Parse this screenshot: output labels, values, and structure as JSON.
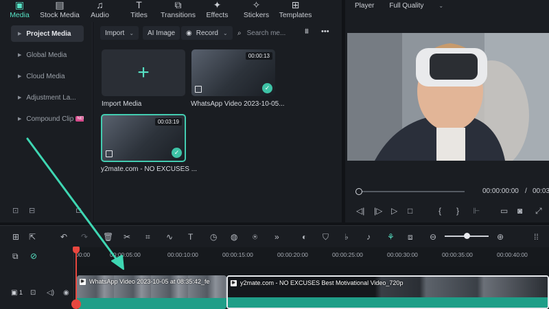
{
  "top_tabs": [
    {
      "label": "Media",
      "icon": "media-icon",
      "active": true
    },
    {
      "label": "Stock Media",
      "icon": "stock-media-icon"
    },
    {
      "label": "Audio",
      "icon": "music-note-icon"
    },
    {
      "label": "Titles",
      "icon": "text-icon"
    },
    {
      "label": "Transitions",
      "icon": "transitions-icon"
    },
    {
      "label": "Effects",
      "icon": "effects-icon"
    },
    {
      "label": "Stickers",
      "icon": "sticker-icon"
    },
    {
      "label": "Templates",
      "icon": "templates-icon"
    }
  ],
  "sidebar": {
    "items": [
      {
        "label": "Project Media",
        "active": true
      },
      {
        "label": "Global Media"
      },
      {
        "label": "Cloud Media"
      },
      {
        "label": "Adjustment La..."
      },
      {
        "label": "Compound Clip",
        "badge": "NEW"
      }
    ]
  },
  "media_toolbar": {
    "import_label": "Import",
    "ai_image_label": "AI Image",
    "record_label": "Record",
    "search_placeholder": "Search me..."
  },
  "media_items": [
    {
      "caption": "Import Media"
    },
    {
      "caption": "WhatsApp Video 2023-10-05...",
      "duration": "00:00:13"
    },
    {
      "caption": "y2mate.com - NO EXCUSES ...",
      "duration": "00:03:19"
    }
  ],
  "player": {
    "label": "Player",
    "quality": "Full Quality",
    "current_time": "00:00:00:00",
    "separator": "/",
    "total_time": "00:03"
  },
  "timeline": {
    "ruler_labels": [
      "00:00",
      "00:00:05:00",
      "00:00:10:00",
      "00:00:15:00",
      "00:00:20:00",
      "00:00:25:00",
      "00:00:30:00",
      "00:00:35:00",
      "00:00:40:00"
    ],
    "clip1_title": "WhatsApp Video 2023-10-05 at 08:35:42_fe",
    "clip2_title": "y2mate.com - NO EXCUSES  Best Motivational Video_720p",
    "track_number": "1"
  },
  "colors": {
    "accent": "#56e0c3",
    "playhead": "#e8473f",
    "waveform": "#1f9e88",
    "annotation_arrow": "#3ed6b2"
  }
}
